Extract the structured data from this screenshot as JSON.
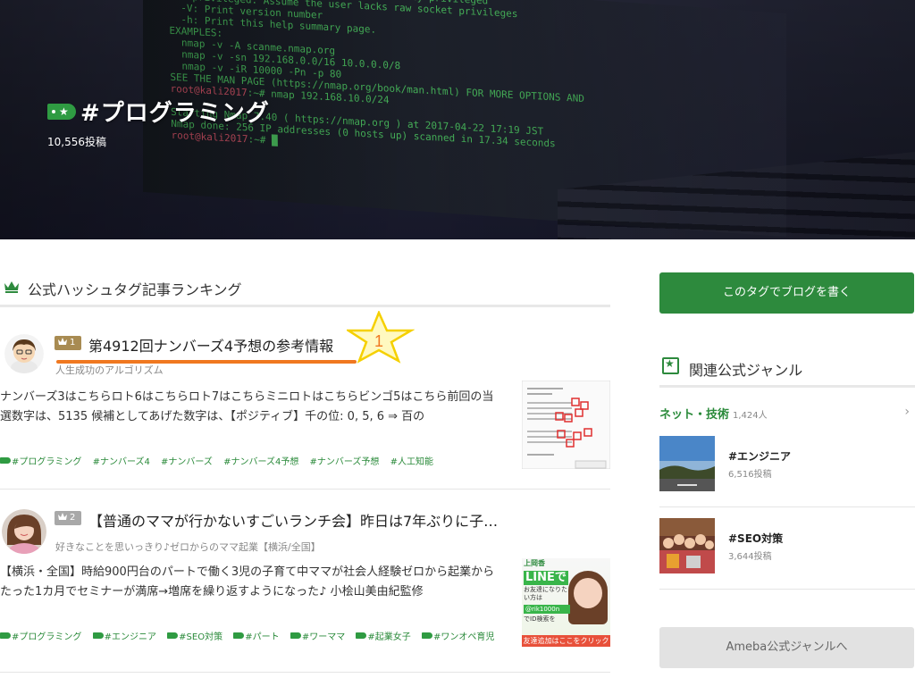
{
  "hero": {
    "title": "#プログラミング",
    "tag_icon": "hashtag-badge-icon",
    "post_count": "10,556投稿"
  },
  "ranking": {
    "heading": "公式ハッシュタグ記事ランキング",
    "articles": [
      {
        "rank": "1",
        "title": "第4912回ナンバーズ4予想の参考情報",
        "author": "人生成功のアルゴリズム",
        "body": "ナンバーズ3はこちらロト6はこちらロト7はこちらミニロトはこちらビンゴ5はこちら前回の当選数字は、5135 候補としてあげた数字は、【ポジティブ】千の位: 0, 5, 6 ⇒ 百の",
        "tags": [
          "#プログラミング",
          "#ナンバーズ4",
          "#ナンバーズ",
          "#ナンバーズ4予想",
          "#ナンバーズ予想",
          "#人工知能"
        ]
      },
      {
        "rank": "2",
        "title": "【普通のママが行かないすごいランチ会】昨日は7年ぶりに子…",
        "author": "好きなことを思いっきり♪ゼロからのママ起業【横浜/全国】",
        "body": "【横浜・全国】時給900円台のパートで働く3児の子育て中ママが社会人経験ゼロから起業からたった1カ月でセミナーが満席→増席を繰り返すようになった♪ 小桧山美由紀監修",
        "tags": [
          "#プログラミング",
          "#エンジニア",
          "#SEO対策",
          "#パート",
          "#ワーママ",
          "#起業女子",
          "#ワンオペ育児"
        ],
        "thumb": {
          "name": "上岡香",
          "line": "LINEで",
          "friend": "お友達になりたい方は",
          "id": "@rik1000n",
          "search": "でID検索を",
          "cta": "友達追加はここをクリック"
        }
      }
    ]
  },
  "annotation": {
    "number": "1",
    "color": "#f07820"
  },
  "sidebar": {
    "write_button": "このタグでブログを書く",
    "related_heading": "関連公式ジャンル",
    "genre": {
      "name": "ネット・技術",
      "count": "1,424人"
    },
    "related_tags": [
      {
        "tag": "#エンジニア",
        "count": "6,516投稿"
      },
      {
        "tag": "#SEO対策",
        "count": "3,644投稿"
      }
    ],
    "ameba_button": "Ameba公式ジャンルへ"
  },
  "colors": {
    "accent": "#2d8a3d",
    "tag_green": "#2a8a3a",
    "gold": "#a88b52",
    "silver": "#a8a8a8"
  }
}
